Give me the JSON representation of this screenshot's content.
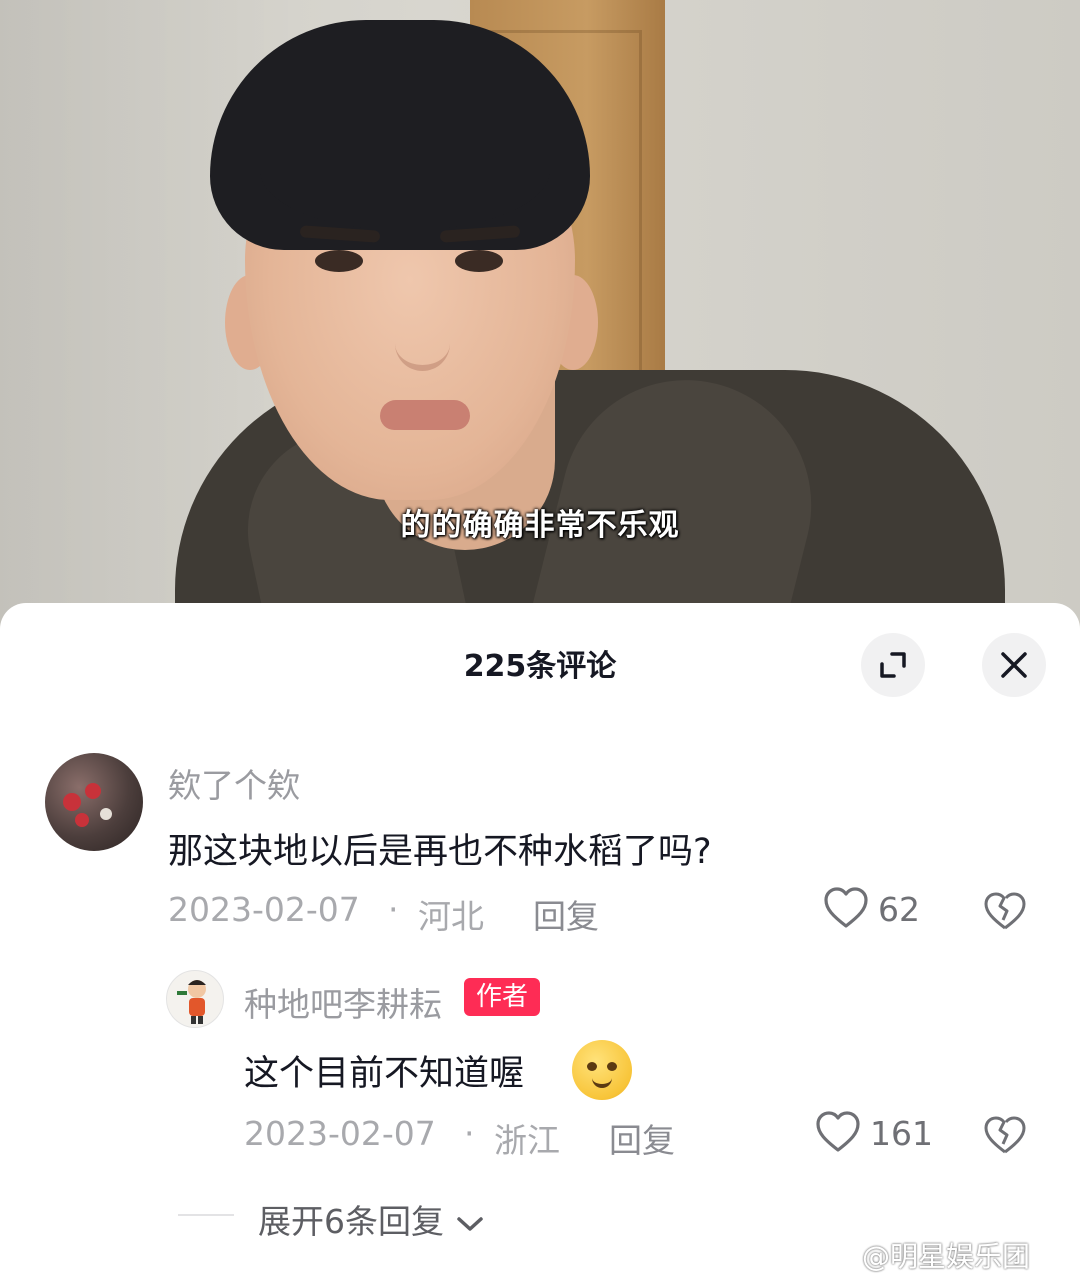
{
  "video": {
    "subtitle": "的的确确非常不乐观"
  },
  "comments_panel": {
    "title": "225条评论",
    "expand_icon": "expand-icon",
    "close_icon": "close-icon"
  },
  "comments": [
    {
      "username": "欸了个欸",
      "text": "那这块地以后是再也不种水稻了吗?",
      "date": "2023-02-07",
      "separator": "·",
      "location": "河北",
      "reply_label": "回复",
      "likes": "62",
      "replies": [
        {
          "username": "种地吧李耕耘",
          "badge": "作者",
          "text": "这个目前不知道喔",
          "emoji": "smirk-emoji",
          "date": "2023-02-07",
          "separator": "·",
          "location": "浙江",
          "reply_label": "回复",
          "likes": "161"
        }
      ],
      "expand_replies_label": "展开6条回复"
    }
  ],
  "watermark": "@明星娱乐团",
  "colors": {
    "badge": "#fe2c55",
    "username": "#9a9ba0",
    "text": "#161823"
  }
}
